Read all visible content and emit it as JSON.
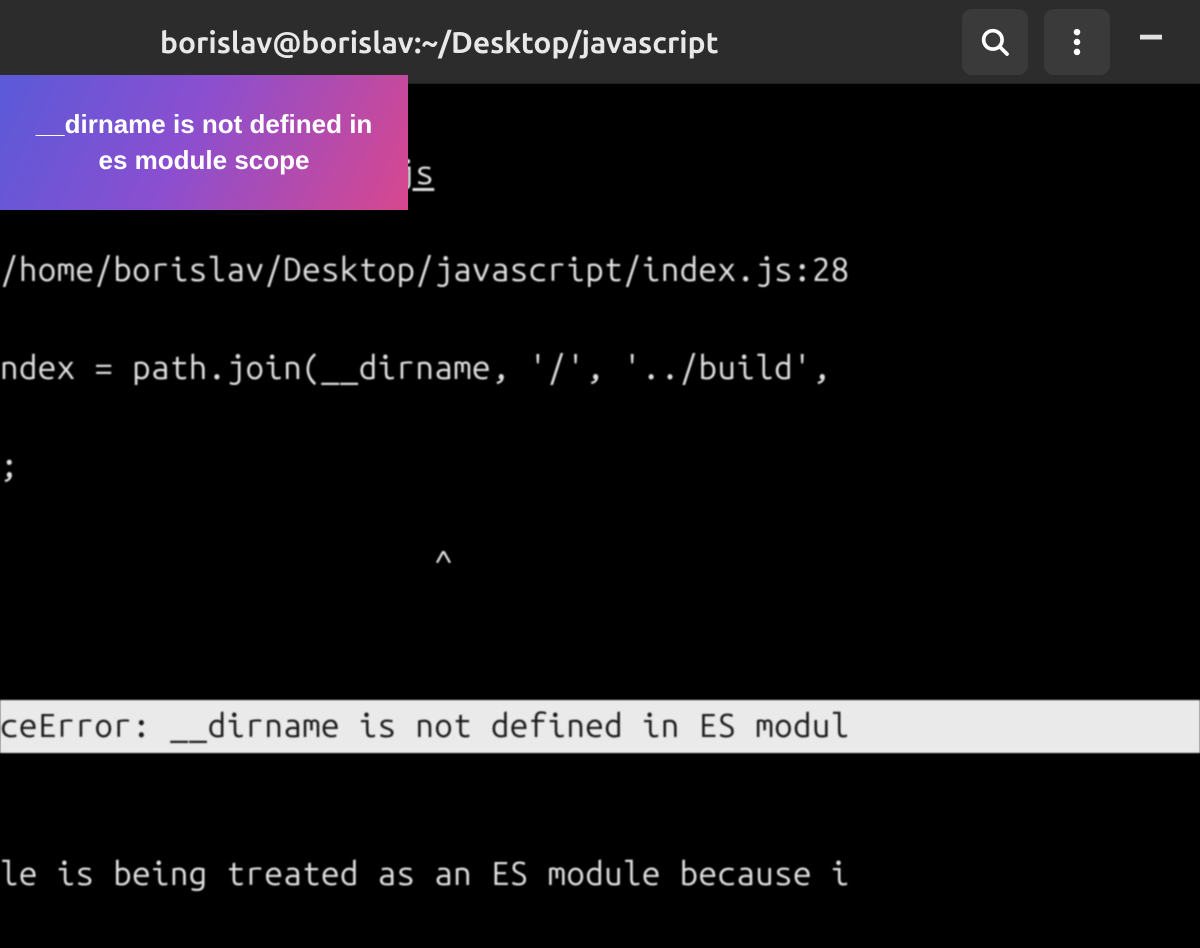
{
  "titlebar": {
    "title": "borislav@borislav:~/Desktop/javascript",
    "search_icon": "search",
    "menu_icon": "menu",
    "minimize": "–"
  },
  "overlay": {
    "text": "__dirname is not defined in es module scope"
  },
  "terminal": {
    "l1_visible": ".js",
    "l2": "/home/borislav/Desktop/javascript/index.js:28",
    "l3": "ndex = path.join(__dirname, '/', '../build', ",
    "l4": ";",
    "l5": "                       ^",
    "l6": "",
    "l7": "ceError: __dirname is not defined in ES modul",
    "l8": "",
    "l9": "le is being treated as an ES module because i"
  },
  "colors": {
    "titlebar_bg": "#2c2c2c",
    "icon_btn_bg": "#3a3a3a",
    "terminal_bg": "#000000",
    "terminal_fg": "#e0e0e0",
    "highlight_bg": "#eaeaea",
    "highlight_fg": "#1a1a1a",
    "badge_grad_start": "#5a5ad8",
    "badge_grad_mid": "#8a4fd0",
    "badge_grad_end": "#d8478e"
  }
}
